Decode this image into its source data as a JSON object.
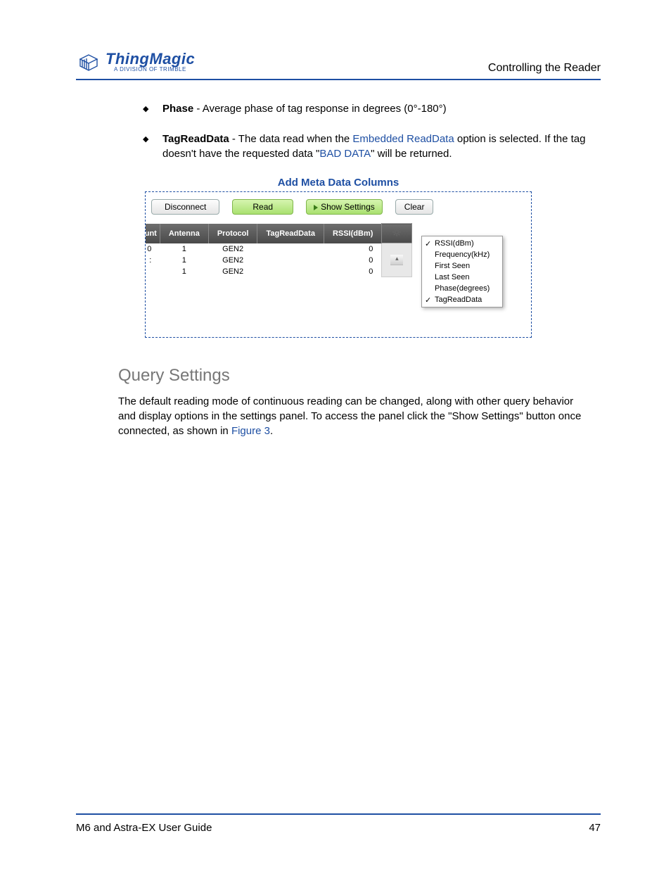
{
  "header": {
    "logo_title": "ThingMagic",
    "logo_subtitle": "A DIVISION OF TRIMBLE",
    "right_text": "Controlling the Reader"
  },
  "bullets": [
    {
      "bold": "Phase",
      "rest": " - Average phase of tag response in degrees (0°-180°)"
    },
    {
      "bold": "TagReadData",
      "rest_1": " - The data read when the ",
      "link": "Embedded ReadData",
      "rest_2": " option is selected. If the tag doesn't have the requested data \"",
      "mid_link": "BAD DATA",
      "rest_3": "\" will be returned."
    }
  ],
  "figure": {
    "caption": "Add Meta Data Columns",
    "toolbar": {
      "disconnect": "Disconnect",
      "read": "Read",
      "show_settings": "Show Settings",
      "clear": "Clear"
    },
    "table": {
      "headers": [
        "ount",
        "Antenna",
        "Protocol",
        "TagReadData",
        "RSSI(dBm)"
      ],
      "rows": [
        {
          "c0": "0",
          "antenna": "1",
          "protocol": "GEN2",
          "trd": "",
          "rssi": "0"
        },
        {
          "c0": ":",
          "antenna": "1",
          "protocol": "GEN2",
          "trd": "",
          "rssi": "0"
        },
        {
          "c0": "",
          "antenna": "1",
          "protocol": "GEN2",
          "trd": "",
          "rssi": "0"
        }
      ]
    },
    "menu": [
      {
        "label": "RSSI(dBm)",
        "checked": true
      },
      {
        "label": "Frequency(kHz)",
        "checked": false
      },
      {
        "label": "First Seen",
        "checked": false
      },
      {
        "label": "Last Seen",
        "checked": false
      },
      {
        "label": "Phase(degrees)",
        "checked": false
      },
      {
        "label": "TagReadData",
        "checked": true
      }
    ]
  },
  "section": {
    "heading": "Query Settings",
    "para_1": "The default reading mode of continuous reading can be changed, along with other query behavior and display options in the settings panel. To access the panel click the \"Show Settings\" button once connected, as shown in ",
    "para_link": "Figure 3",
    "para_2": "."
  },
  "footer": {
    "left": "M6 and Astra-EX User Guide",
    "right": "47"
  }
}
